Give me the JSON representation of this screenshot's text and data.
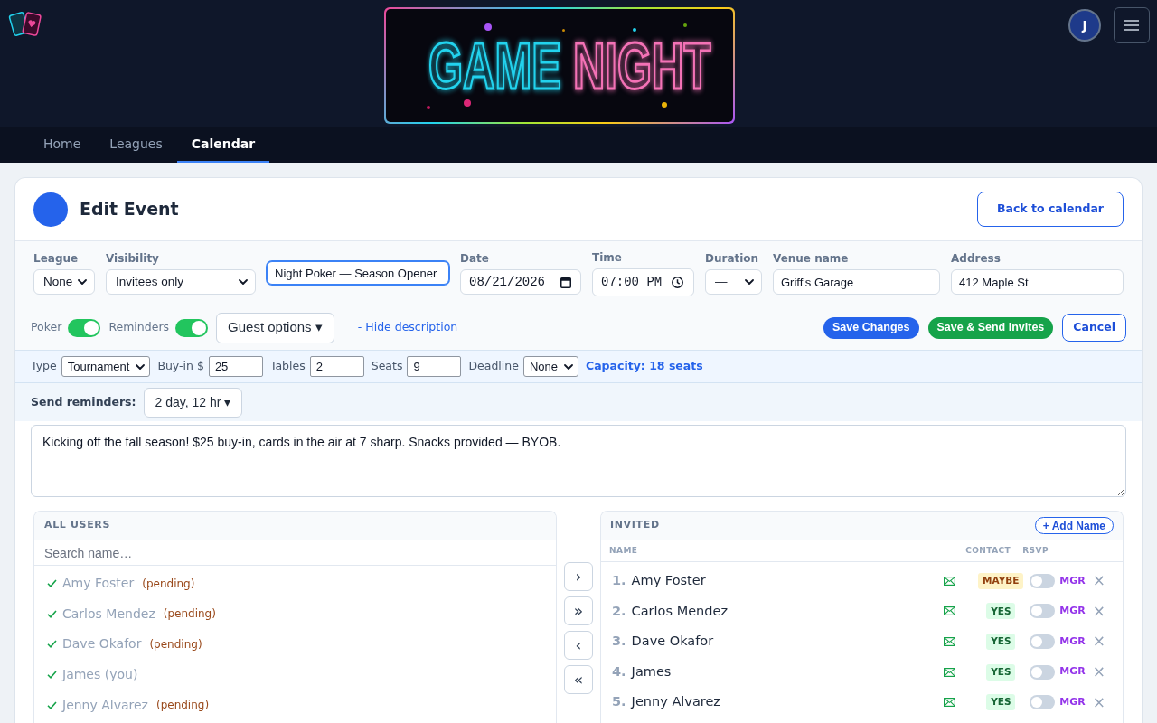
{
  "header": {
    "banner": {
      "words": [
        "GAME",
        "NIGHT"
      ]
    },
    "avatar": {
      "initial": "J"
    }
  },
  "nav": {
    "tabs": [
      {
        "label": "Home",
        "selected": false
      },
      {
        "label": "Leagues",
        "selected": false
      },
      {
        "label": "Calendar",
        "selected": true
      }
    ]
  },
  "event": {
    "title": "Edit Event",
    "back_button": "Back to calendar"
  },
  "fields": [
    {
      "kind": "select",
      "label": "League",
      "value": "None",
      "focused": false
    },
    {
      "kind": "select",
      "label": "Visibility",
      "value": "Invitees only",
      "focused": false
    },
    {
      "kind": "text",
      "value": "Night Poker — Season Opener",
      "focused": true
    },
    {
      "kind": "date",
      "label": "Date",
      "value": "08/21/2026",
      "focused": false
    },
    {
      "kind": "time",
      "label": "Time",
      "value": "07:00 PM",
      "focused": false
    },
    {
      "kind": "select",
      "label": "Duration",
      "value": "—",
      "focused": false
    },
    {
      "kind": "text",
      "label": "Venue name",
      "value": "Griff's Garage",
      "focused": false
    },
    {
      "kind": "text",
      "label": "Address",
      "value": "412 Maple St",
      "focused": false
    }
  ],
  "toolbar": {
    "toggles": [
      {
        "label": "Poker",
        "on": true
      },
      {
        "label": "Reminders",
        "on": true
      }
    ],
    "guest_options": "Guest options ▾",
    "description_toggle": "- Hide description",
    "actions": [
      {
        "kind": "primary",
        "label": "Save Changes"
      },
      {
        "kind": "success",
        "label": "Save & Send Invites"
      },
      {
        "kind": "outline",
        "label": "Cancel"
      }
    ]
  },
  "poker": {
    "fields": [
      {
        "kind": "select",
        "label": "Type",
        "value": "Tournament"
      },
      {
        "kind": "input",
        "label": "Buy-in $",
        "value": "25"
      },
      {
        "kind": "input",
        "label": "Tables",
        "value": "2"
      },
      {
        "kind": "input",
        "label": "Seats",
        "value": "9"
      },
      {
        "kind": "select",
        "label": "Deadline",
        "value": "None"
      }
    ],
    "capacity": "Capacity: 18 seats"
  },
  "reminders": {
    "label": "Send reminders:",
    "value": "2 day, 12 hr ▾"
  },
  "description": "Kicking off the fall season! $25 buy-in, cards in the air at 7 sharp. Snacks provided — BYOB.",
  "all_users": {
    "title": "ALL USERS",
    "search_placeholder": "Search name…",
    "items": [
      {
        "name": "Amy Foster",
        "note": "(pending)",
        "checked": true
      },
      {
        "name": "Carlos Mendez",
        "note": "(pending)",
        "checked": true
      },
      {
        "name": "Dave Okafor",
        "note": "(pending)",
        "checked": true
      },
      {
        "name": "James (you)",
        "checked": true
      },
      {
        "name": "Jenny Alvarez",
        "note": "(pending)",
        "checked": true
      }
    ]
  },
  "transfer_buttons": [
    "›",
    "»",
    "‹",
    "«"
  ],
  "invited": {
    "title": "INVITED",
    "add_button": "+ Add Name",
    "columns": [
      "NAME",
      "CONTACT",
      "RSVP"
    ],
    "rows": [
      {
        "number": "1.",
        "name": "Amy Foster",
        "rsvp": {
          "label": "MAYBE",
          "kind": "maybe"
        },
        "manager": false,
        "manager_label": "MGR",
        "remove": "×"
      },
      {
        "number": "2.",
        "name": "Carlos Mendez",
        "rsvp": {
          "label": "YES",
          "kind": "yes"
        },
        "manager": false,
        "manager_label": "MGR",
        "remove": "×"
      },
      {
        "number": "3.",
        "name": "Dave Okafor",
        "rsvp": {
          "label": "YES",
          "kind": "yes"
        },
        "manager": false,
        "manager_label": "MGR",
        "remove": "×"
      },
      {
        "number": "4.",
        "name": "James",
        "rsvp": {
          "label": "YES",
          "kind": "yes"
        },
        "manager": false,
        "manager_label": "MGR",
        "remove": "×"
      },
      {
        "number": "5.",
        "name": "Jenny Alvarez",
        "rsvp": {
          "label": "YES",
          "kind": "yes"
        },
        "manager": false,
        "manager_label": "MGR",
        "remove": "×"
      }
    ]
  }
}
